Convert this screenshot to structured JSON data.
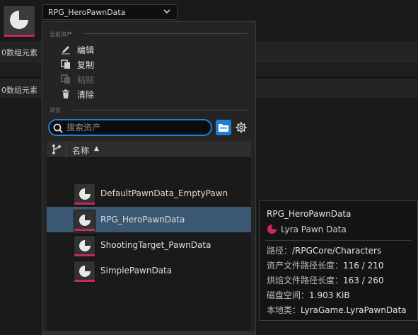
{
  "background": {
    "row_labels": [
      "0数组元素",
      "0数组元素"
    ]
  },
  "asset_picker": {
    "selected": "RPG_HeroPawnData"
  },
  "menu": {
    "current_asset_header": "当前资产",
    "edit": "编辑",
    "copy": "复制",
    "paste": "粘贴",
    "clear": "清除",
    "browse_header": "浏览",
    "search_placeholder": "搜索资产",
    "column_name": "名称",
    "items": [
      {
        "label": "DefaultPawnData_EmptyPawn"
      },
      {
        "label": "RPG_HeroPawnData"
      },
      {
        "label": "ShootingTarget_PawnData"
      },
      {
        "label": "SimplePawnData"
      }
    ]
  },
  "tooltip": {
    "title": "RPG_HeroPawnData",
    "type_label": "Lyra Pawn Data",
    "path_key": "路径：",
    "path_val": "/RPGCore/Characters",
    "asset_path_len_key": "资产文件路径长度：",
    "asset_path_len_val": "116 / 210",
    "cooked_path_len_key": "烘焙文件路径长度：",
    "cooked_path_len_val": "163 / 260",
    "disk_key": "磁盘空间：",
    "disk_val": "1.903 KiB",
    "native_class_key": "本地类：",
    "native_class_val": "LyraGame.LyraPawnData"
  },
  "colors": {
    "accent": "#1f7fd6",
    "selection": "#3a5872",
    "asset_stripe": "#c8285a"
  },
  "icons": {
    "edit": "pencil-icon",
    "copy": "copy-icon",
    "paste": "paste-icon",
    "clear": "trash-icon",
    "search": "search-icon",
    "folder": "folder-icon",
    "settings": "gear-icon",
    "branch": "branch-icon",
    "asset": "pawn-data-icon"
  }
}
